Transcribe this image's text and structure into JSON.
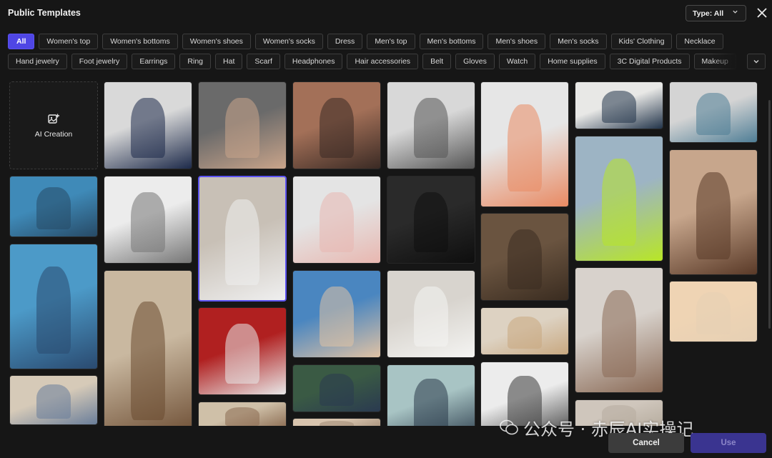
{
  "header": {
    "title": "Public Templates",
    "type_filter": "Type: All"
  },
  "categories_row1": [
    "All",
    "Women's top",
    "Women's bottoms",
    "Women's shoes",
    "Women's socks",
    "Dress",
    "Men's top",
    "Men's bottoms",
    "Men's shoes",
    "Men's socks",
    "Kids' Clothing",
    "Necklace"
  ],
  "categories_row2": [
    "Hand jewelry",
    "Foot jewelry",
    "Earrings",
    "Ring",
    "Hat",
    "Scarf",
    "Headphones",
    "Hair accessories",
    "Belt",
    "Gloves",
    "Watch",
    "Home supplies",
    "3C Digital Products",
    "Makeup"
  ],
  "active_category": "All",
  "ai_tile": {
    "label": "AI Creation"
  },
  "templates": [
    {
      "name": "template-man-navy-sweater-beret",
      "colors": [
        "#d9d9d9",
        "#1d2a4a"
      ]
    },
    {
      "name": "template-man-earbud-profile",
      "colors": [
        "#6a6a6a",
        "#c9a48a"
      ]
    },
    {
      "name": "template-woman-lip-gloss",
      "colors": [
        "#a37058",
        "#3a2a24"
      ]
    },
    {
      "name": "template-woman-suitcases",
      "colors": [
        "#d8d8d8",
        "#555"
      ]
    },
    {
      "name": "template-woman-floral-romper",
      "colors": [
        "#e6e6e6",
        "#e98a63"
      ]
    },
    {
      "name": "template-navy-armchair",
      "colors": [
        "#e8e8e6",
        "#22344a"
      ]
    },
    {
      "name": "template-striped-socks",
      "colors": [
        "#d4d4d4",
        "#4f7e96"
      ]
    },
    {
      "name": "template-denim-shorts-blue",
      "colors": [
        "#3f8ab8",
        "#274a66"
      ]
    },
    {
      "name": "template-man-gray-shirt",
      "colors": [
        "#ececec",
        "#777"
      ]
    },
    {
      "name": "template-portable-air-conditioner",
      "colors": [
        "#c8c0b6",
        "#efefef"
      ]
    },
    {
      "name": "template-bathroom-skincare",
      "colors": [
        "#e4e4e4",
        "#e8b7b0"
      ]
    },
    {
      "name": "template-car-infotainment",
      "colors": [
        "#2a2a2a",
        "#0e0e0e"
      ]
    },
    {
      "name": "template-man-swim-trunks",
      "colors": [
        "#9db4c4",
        "#b8e626"
      ]
    },
    {
      "name": "template-woman-bronze-portrait",
      "colors": [
        "#c7a68c",
        "#5a3a28"
      ]
    },
    {
      "name": "template-woman-denim-sneakers",
      "colors": [
        "#4c9ac8",
        "#2a4a70"
      ]
    },
    {
      "name": "template-fork-kitchen",
      "colors": [
        "#c9b8a0",
        "#6a4a30"
      ]
    },
    {
      "name": "template-hiking-boots",
      "colors": [
        "#6a5440",
        "#3a2c20"
      ]
    },
    {
      "name": "template-foot-anklet",
      "colors": [
        "#4a86c0",
        "#e0c2a4"
      ]
    },
    {
      "name": "template-woman-kitchen-phone",
      "colors": [
        "#d8d4ce",
        "#f4f4f2"
      ]
    },
    {
      "name": "template-racing-helmet",
      "colors": [
        "#b02020",
        "#e8e8e8"
      ]
    },
    {
      "name": "template-woman-ring-portrait",
      "colors": [
        "#d8d2cc",
        "#8a6a56"
      ]
    },
    {
      "name": "template-man-holding-can",
      "colors": [
        "#efd4b4",
        "#e6d0b4"
      ]
    },
    {
      "name": "template-child-smiling",
      "colors": [
        "#ddd2c2",
        "#c8a880"
      ]
    },
    {
      "name": "template-hand-serum",
      "colors": [
        "#3a5a44",
        "#2a3a50"
      ]
    },
    {
      "name": "template-man-teal-sweater",
      "colors": [
        "#a8c4c4",
        "#2a3a4a"
      ]
    },
    {
      "name": "template-jeans-belt",
      "colors": [
        "#d6cab8",
        "#6a7e9a"
      ]
    },
    {
      "name": "template-woman-white-shirt-bottle",
      "colors": [
        "#ececec",
        "#3a3a3a"
      ]
    },
    {
      "name": "template-man-portrait-bottom",
      "colors": [
        "#cfc0a8",
        "#8a6a50"
      ]
    },
    {
      "name": "template-neutral-bottom-1",
      "colors": [
        "#cfc6bc",
        "#b6ac9e"
      ]
    },
    {
      "name": "template-neutral-bottom-2",
      "colors": [
        "#d8c4ae",
        "#a08a74"
      ]
    }
  ],
  "footer": {
    "cancel": "Cancel",
    "use": "Use"
  },
  "watermark": "公众号 · 赤辰AI实操记",
  "colors": {
    "accent": "#4f46e5",
    "background": "#161616",
    "chip_border": "#3e3e3e"
  }
}
